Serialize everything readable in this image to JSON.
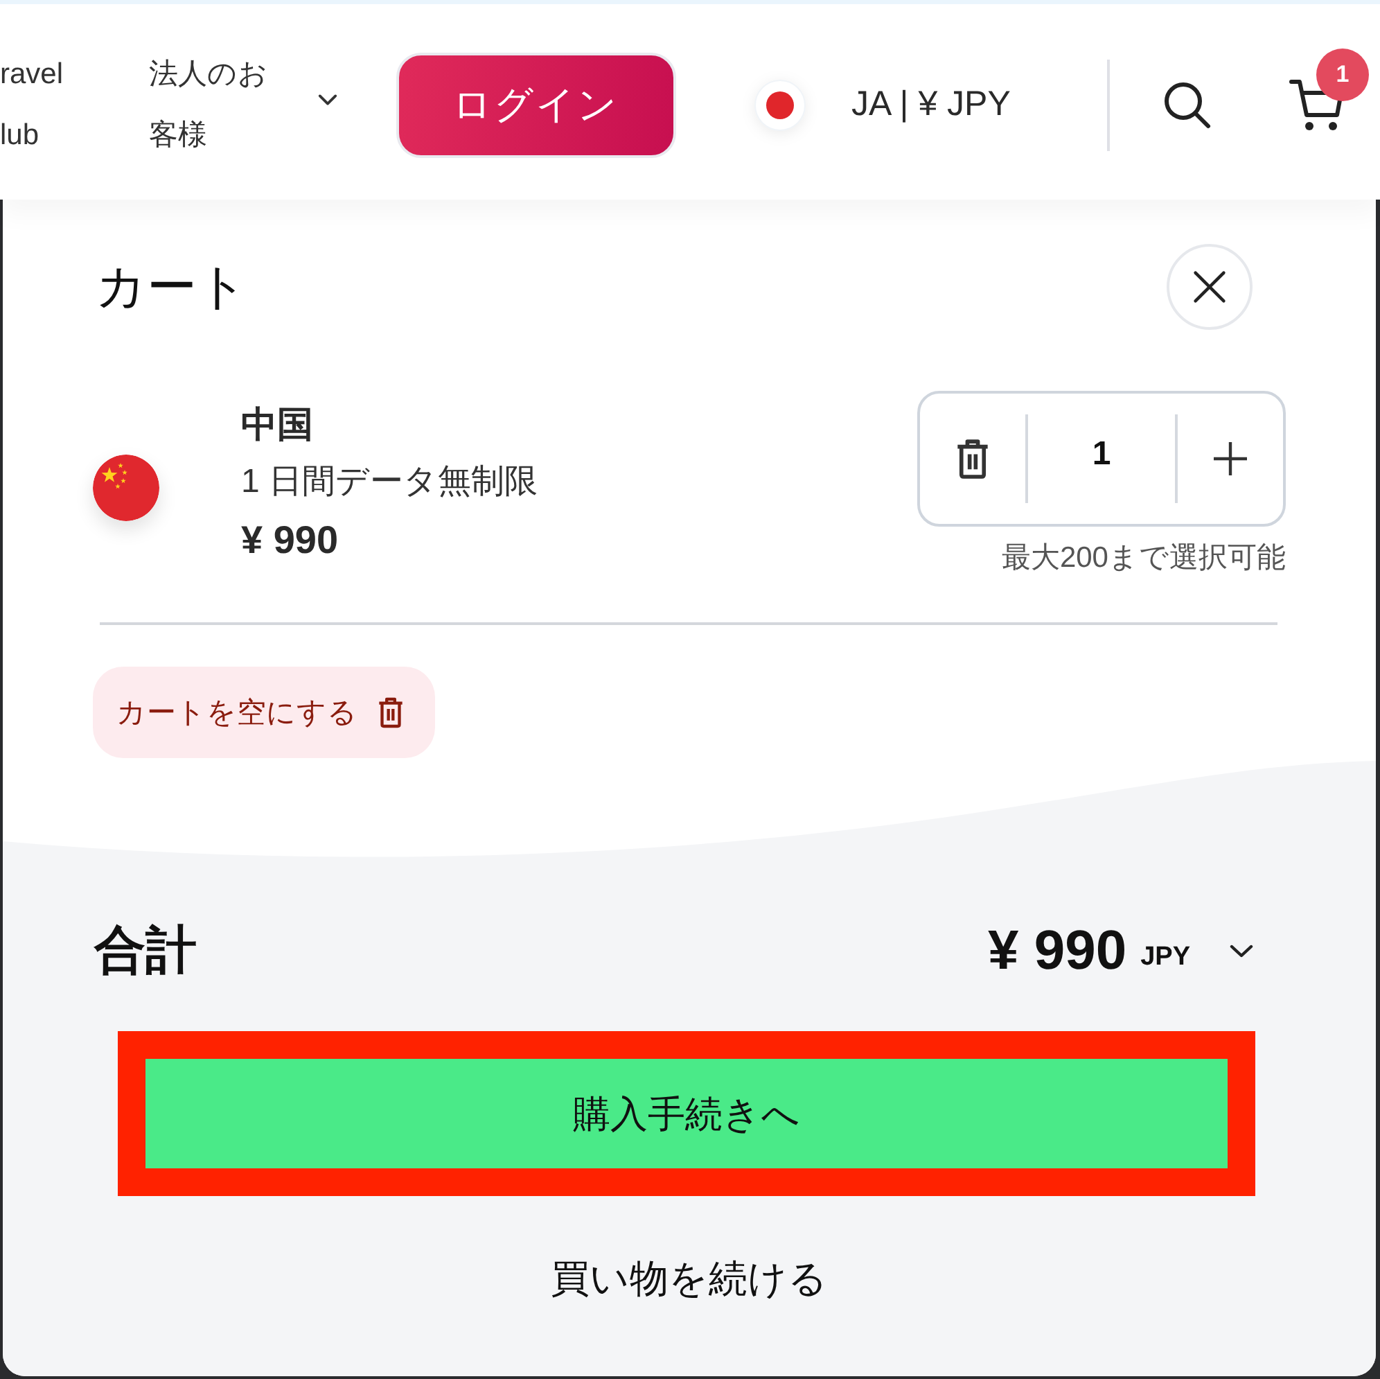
{
  "header": {
    "nav_links": [
      {
        "lines": [
          "ravel",
          "lub"
        ],
        "has_dropdown": false
      },
      {
        "lines": [
          "法人のお",
          "客様"
        ],
        "has_dropdown": true
      }
    ],
    "login_button": "ログイン",
    "locale": "JA | ¥ JPY",
    "cart_count": "1"
  },
  "cart": {
    "title": "カート",
    "items": [
      {
        "country": "中国",
        "plan": "1 日間データ無制限",
        "price": "¥ 990",
        "quantity": "1",
        "limit_note": "最大200まで選択可能"
      }
    ],
    "empty_cart_button": "カートを空にする",
    "total": {
      "label": "合計",
      "amount": "¥ 990",
      "currency": "JPY"
    },
    "checkout_button": {
      "label": "購入手続きへ",
      "highlighted": true
    },
    "continue_button": "買い物を続ける"
  }
}
